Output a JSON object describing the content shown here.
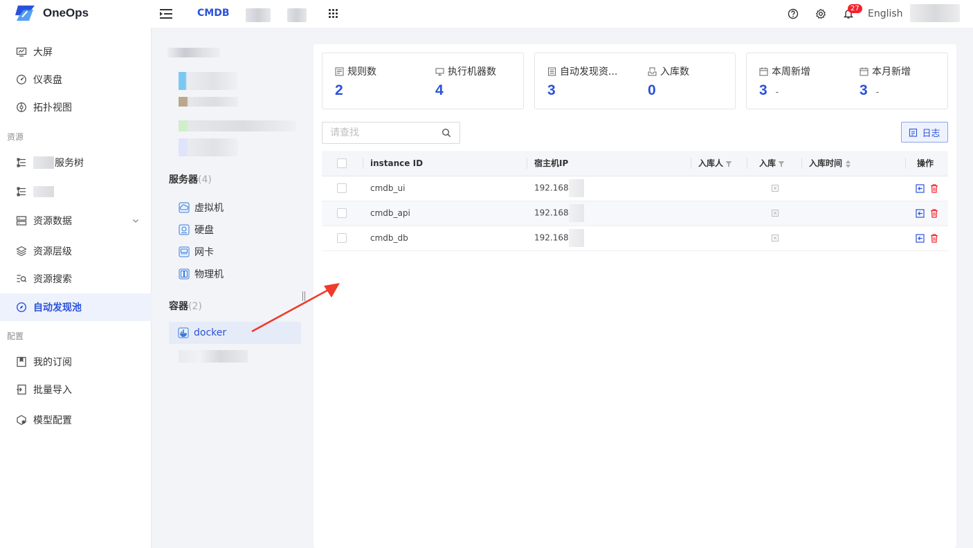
{
  "app": {
    "name": "OneOps",
    "nav_active": "CMDB",
    "language": "English",
    "notification_count": "27"
  },
  "sidebar": {
    "items": [
      {
        "label": "大屏",
        "icon": "monitor-icon"
      },
      {
        "label": "仪表盘",
        "icon": "gauge-icon"
      },
      {
        "label": "拓扑视图",
        "icon": "topology-icon"
      }
    ],
    "section_resources": "资源",
    "resource_items": [
      {
        "label": "服务树",
        "icon": "tree-icon"
      },
      {
        "label": "",
        "icon": "tree-icon"
      },
      {
        "label": "资源数据",
        "icon": "server-icon"
      },
      {
        "label": "资源层级",
        "icon": "layers-icon"
      },
      {
        "label": "资源搜索",
        "icon": "list-search-icon"
      },
      {
        "label": "自动发现池",
        "icon": "compass-icon"
      }
    ],
    "section_config": "配置",
    "config_items": [
      {
        "label": "我的订阅",
        "icon": "bookmark-icon"
      },
      {
        "label": "批量导入",
        "icon": "import-icon"
      },
      {
        "label": "模型配置",
        "icon": "model-icon"
      }
    ]
  },
  "tree": {
    "servers_title": "服务器",
    "servers_count": "(4)",
    "servers": [
      {
        "label": "虚拟机",
        "icon": "cloud-vm-icon"
      },
      {
        "label": "硬盘",
        "icon": "disk-icon"
      },
      {
        "label": "网卡",
        "icon": "nic-icon"
      },
      {
        "label": "物理机",
        "icon": "physical-server-icon"
      }
    ],
    "containers_title": "容器",
    "containers_count": "(2)",
    "containers": [
      {
        "label": "docker",
        "icon": "docker-icon"
      }
    ]
  },
  "stats": [
    {
      "label": "规则数",
      "value": "2",
      "icon": "rules-icon"
    },
    {
      "label": "执行机器数",
      "value": "4",
      "icon": "machine-icon"
    },
    {
      "label": "自动发现资...",
      "value": "3",
      "icon": "discover-icon"
    },
    {
      "label": "入库数",
      "value": "0",
      "icon": "inbound-icon"
    },
    {
      "label": "本周新增",
      "value": "3",
      "suffix": "-",
      "icon": "calendar-icon"
    },
    {
      "label": "本月新增",
      "value": "3",
      "suffix": "-",
      "icon": "calendar-icon"
    }
  ],
  "search": {
    "placeholder": "请查找"
  },
  "log_button": "日志",
  "table": {
    "headers": [
      "instance ID",
      "宿主机IP",
      "入库人",
      "入库",
      "入库时间",
      "操作"
    ],
    "rows": [
      {
        "instance_id": "cmdb_ui",
        "host_ip": "192.168"
      },
      {
        "instance_id": "cmdb_api",
        "host_ip": "192.168"
      },
      {
        "instance_id": "cmdb_db",
        "host_ip": "192.168"
      }
    ]
  },
  "colors": {
    "accent": "#2a52d9",
    "danger": "#f5222d",
    "annotation_arrow": "#ee3b2b"
  }
}
